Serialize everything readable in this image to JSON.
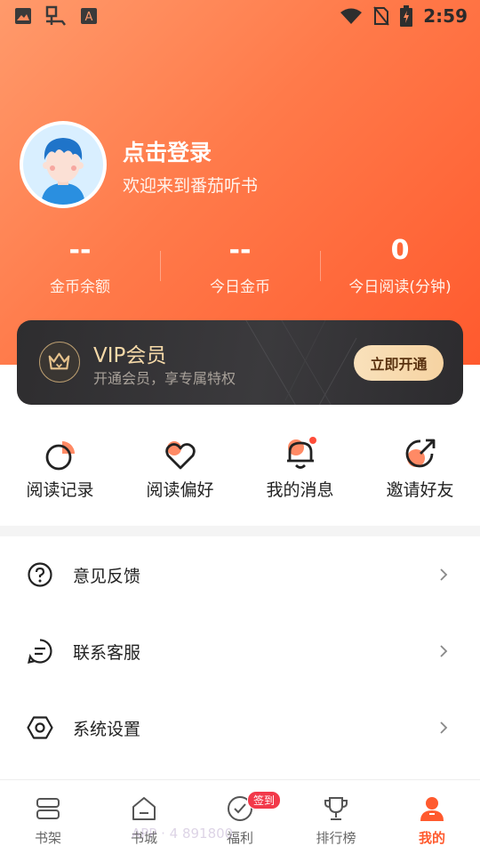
{
  "status_bar": {
    "time": "2:59",
    "left_icons": [
      "image-icon",
      "app-icon",
      "font-icon"
    ],
    "right_icons": [
      "wifi-icon",
      "no-sim-icon",
      "battery-icon"
    ]
  },
  "profile": {
    "title": "点击登录",
    "subtitle": "欢迎来到番茄听书"
  },
  "stats": [
    {
      "value": "--",
      "label": "金币余额"
    },
    {
      "value": "--",
      "label": "今日金币"
    },
    {
      "value": "0",
      "label": "今日阅读(分钟)"
    }
  ],
  "vip": {
    "title": "VIP会员",
    "subtitle": "开通会员，享专属特权",
    "button": "立即开通"
  },
  "actions": [
    {
      "label": "阅读记录",
      "icon": "reading-history-icon"
    },
    {
      "label": "阅读偏好",
      "icon": "reading-preference-icon"
    },
    {
      "label": "我的消息",
      "icon": "bell-icon"
    },
    {
      "label": "邀请好友",
      "icon": "invite-icon"
    }
  ],
  "menu": [
    {
      "label": "意见反馈",
      "icon": "question-icon"
    },
    {
      "label": "联系客服",
      "icon": "chat-icon"
    },
    {
      "label": "系统设置",
      "icon": "settings-icon"
    }
  ],
  "bottom_nav": {
    "items": [
      {
        "label": "书架",
        "icon": "bookshelf-icon"
      },
      {
        "label": "书城",
        "icon": "bookstore-icon"
      },
      {
        "label": "福利",
        "icon": "welfare-icon"
      },
      {
        "label": "排行榜",
        "icon": "trophy-icon"
      },
      {
        "label": "我的",
        "icon": "person-icon"
      }
    ],
    "badge": "签到",
    "active": "我的"
  },
  "watermark": "APP · 4  891800.",
  "colors": {
    "accent": "#ff5a2e",
    "gradient_start": "#ff9a6b",
    "vip_bg": "#2e2d2f",
    "vip_gold": "#f5d9a8"
  }
}
